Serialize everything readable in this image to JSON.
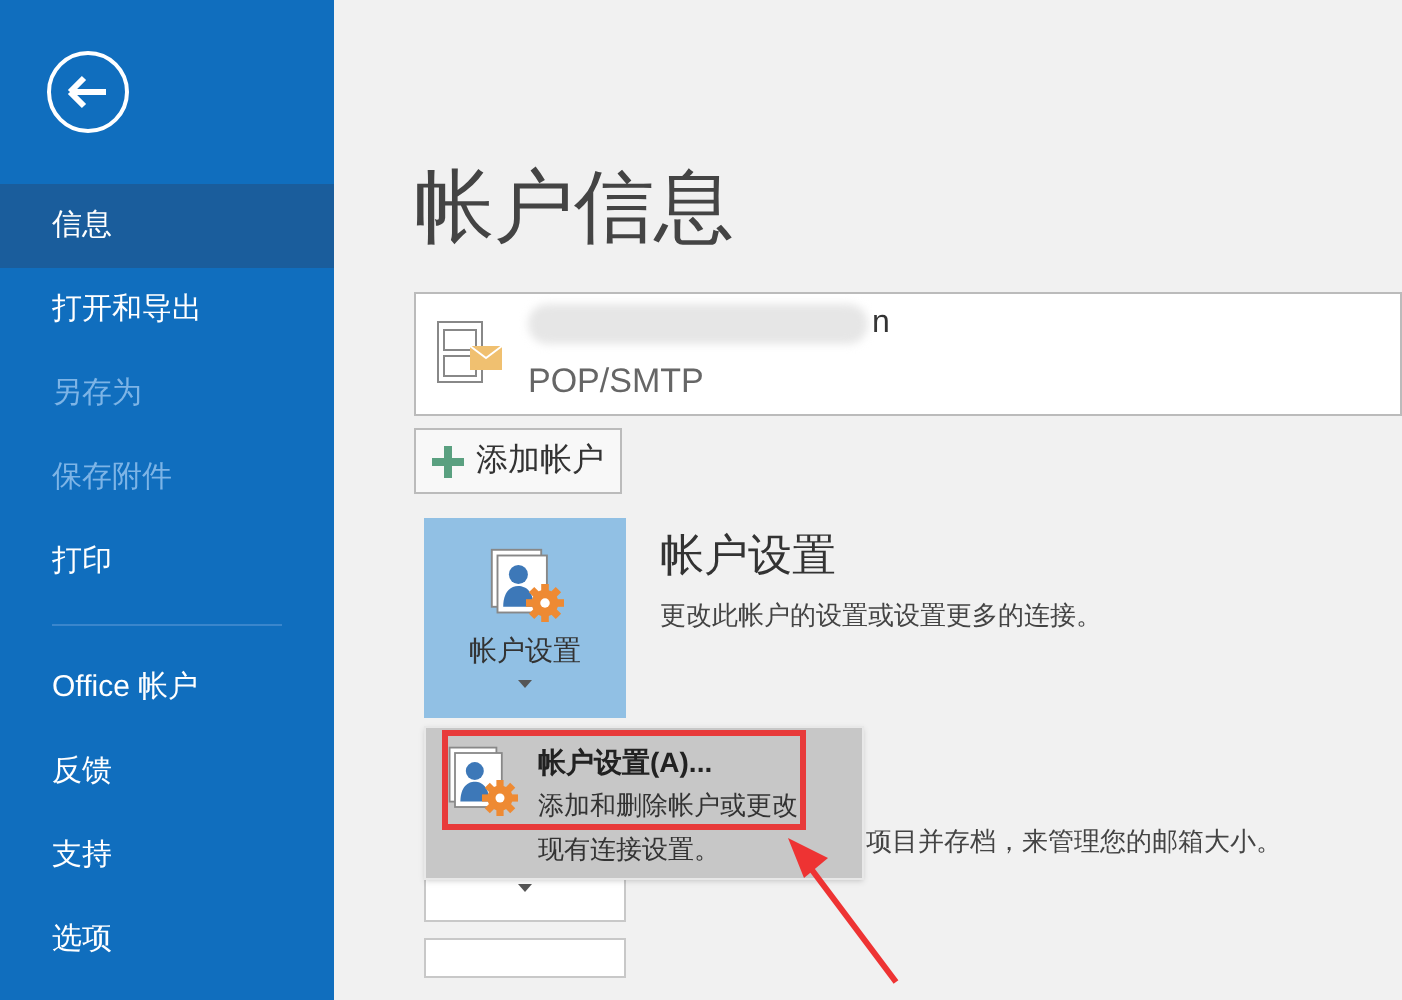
{
  "sidebar": {
    "groups": [
      [
        {
          "label": "信息",
          "selected": true,
          "disabled": false
        },
        {
          "label": "打开和导出",
          "selected": false,
          "disabled": false
        },
        {
          "label": "另存为",
          "selected": false,
          "disabled": true
        },
        {
          "label": "保存附件",
          "selected": false,
          "disabled": true
        },
        {
          "label": "打印",
          "selected": false,
          "disabled": false
        }
      ],
      [
        {
          "label": "Office 帐户",
          "selected": false,
          "disabled": false
        },
        {
          "label": "反馈",
          "selected": false,
          "disabled": false
        },
        {
          "label": "支持",
          "selected": false,
          "disabled": false
        },
        {
          "label": "选项",
          "selected": false,
          "disabled": false
        }
      ]
    ]
  },
  "title": "帐户信息",
  "account": {
    "name": "n",
    "type": "POP/SMTP"
  },
  "add_account_button": "添加帐户",
  "account_settings": {
    "button": "帐户设置",
    "title": "帐户设置",
    "description": "更改此帐户的设置或设置更多的连接。"
  },
  "cleanup": {
    "description": "项目并存档，来管理您的邮箱大小。"
  },
  "menu": {
    "items": [
      {
        "title": "帐户设置(A)...",
        "description": "添加和删除帐户或更改现有连接设置。",
        "highlighted": true
      }
    ]
  }
}
